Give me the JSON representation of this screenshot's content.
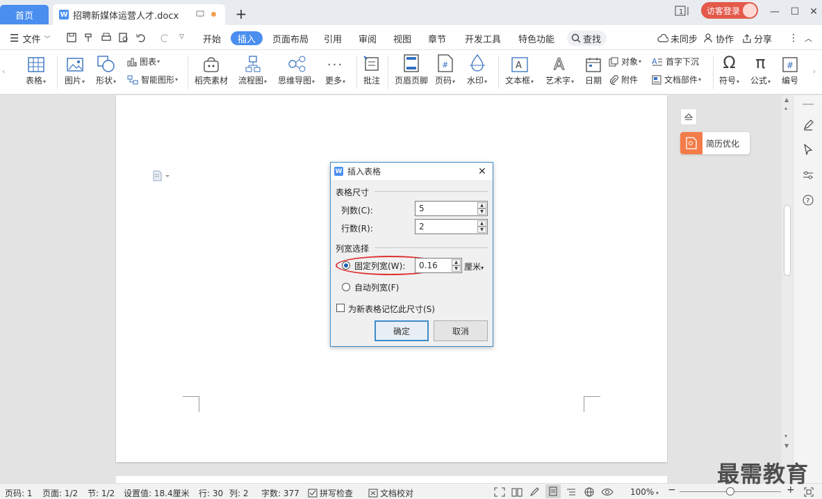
{
  "tabs": {
    "home": "首页",
    "doc": "招聘新媒体运营人才.docx",
    "add": "+"
  },
  "visitor_login": "访客登录",
  "menu": {
    "file": "文件",
    "tabs": [
      "开始",
      "插入",
      "页面布局",
      "引用",
      "审阅",
      "视图",
      "章节",
      "开发工具",
      "特色功能"
    ],
    "search": "查找",
    "unsynced": "未同步",
    "collab": "协作",
    "share": "分享"
  },
  "ribbon": {
    "table": "表格",
    "picture": "图片",
    "shape": "形状",
    "chart": "图表",
    "smart_graphic": "智能图形",
    "material": "稻壳素材",
    "flowchart": "流程图",
    "mindmap": "思维导图",
    "more": "更多",
    "comment": "批注",
    "header_footer": "页眉页脚",
    "page_number": "页码",
    "watermark": "水印",
    "textbox": "文本框",
    "wordart": "艺术字",
    "date": "日期",
    "object": "对象",
    "attachment": "附件",
    "dropcap": "首字下沉",
    "doc_parts": "文档部件",
    "symbol": "符号",
    "formula": "公式",
    "numbering": "编号"
  },
  "side": {
    "resume": "简历优化"
  },
  "dialog": {
    "title": "插入表格",
    "size_section": "表格尺寸",
    "cols_label": "列数(C):",
    "cols_value": "5",
    "rows_label": "行数(R):",
    "rows_value": "2",
    "width_section": "列宽选择",
    "fixed_label": "固定列宽(W):",
    "fixed_value": "0.16",
    "unit": "厘米",
    "auto_label": "自动列宽(F)",
    "remember_label": "为新表格记忆此尺寸(S)",
    "ok": "确定",
    "cancel": "取消"
  },
  "status": {
    "page": "页码: 1",
    "pages": "页面: 1/2",
    "section": "节: 1/2",
    "setting": "设置值: 18.4厘米",
    "row": "行: 30",
    "col": "列: 2",
    "words": "字数: 377",
    "spellcheck": "拼写检查",
    "proof": "文档校对",
    "zoom": "100%"
  },
  "watermark": "最需教育",
  "colors": {
    "accent": "#4a8ef0",
    "visitor": "#e35a4b",
    "resume": "#f37c4a",
    "highlight": "#e03030"
  }
}
